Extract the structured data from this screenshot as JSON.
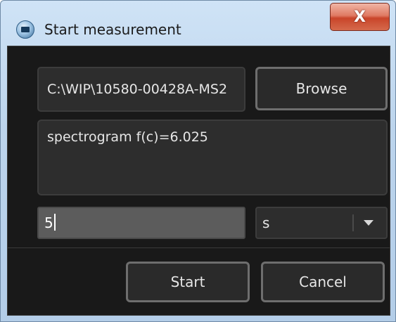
{
  "window": {
    "title": "Start measurement",
    "close_label": "X"
  },
  "file": {
    "path": "C:\\WIP\\10580-00428A-MS2",
    "browse_label": "Browse"
  },
  "info": {
    "text": "spectrogram f(c)=6.025"
  },
  "duration": {
    "value": "5",
    "unit": "s"
  },
  "actions": {
    "start_label": "Start",
    "cancel_label": "Cancel"
  },
  "icons": {
    "app": "measurement-app-icon",
    "close": "close-icon",
    "dropdown": "chevron-down-icon"
  },
  "colors": {
    "client_bg": "#191919",
    "field_bg": "#2d2d2d",
    "active_input_bg": "#5c5c5c",
    "close_button": "#c9452a"
  }
}
